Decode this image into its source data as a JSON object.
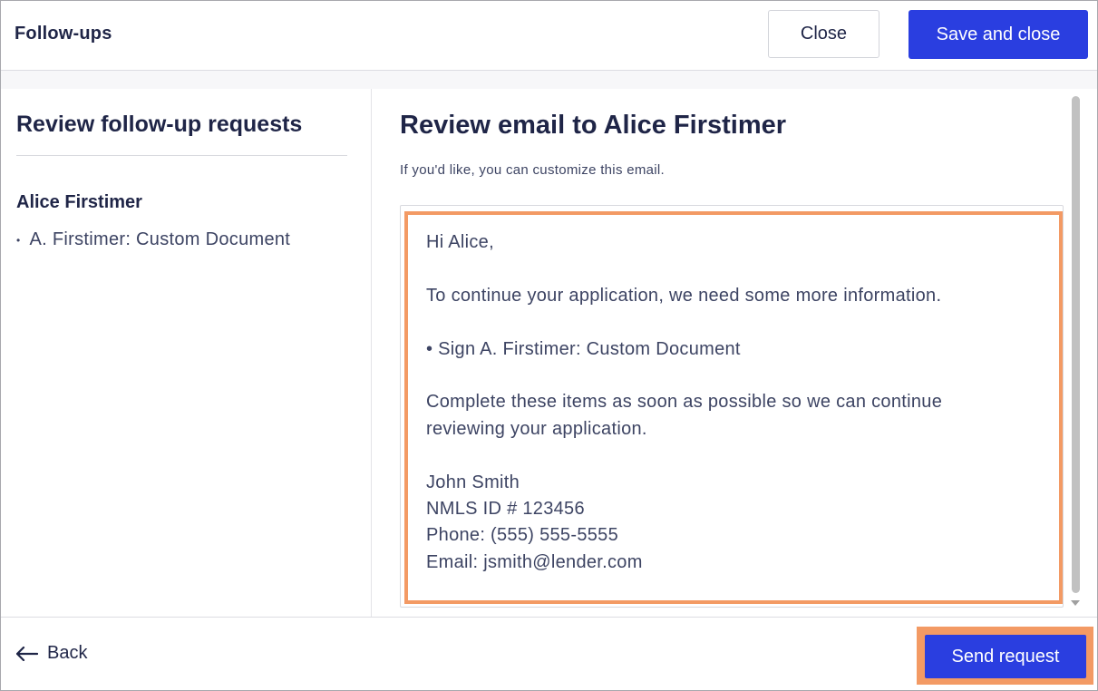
{
  "header": {
    "title": "Follow-ups",
    "close_label": "Close",
    "save_label": "Save and close"
  },
  "left_panel": {
    "heading": "Review follow-up requests",
    "borrower_name": "Alice Firstimer",
    "items": [
      {
        "bullet": "•",
        "label": "A. Firstimer: Custom Document"
      }
    ]
  },
  "right_panel": {
    "heading": "Review email to Alice Firstimer",
    "subtext": "If you'd like, you can customize this email.",
    "email": {
      "greeting": "Hi Alice,",
      "intro": "To continue your application, we need some more information.",
      "request_item": "• Sign A. Firstimer: Custom Document",
      "closing_line1": "Complete these items as soon as possible so we can continue",
      "closing_line2": "reviewing your application.",
      "sig_name": "John Smith",
      "sig_nmls": "NMLS ID # 123456",
      "sig_phone": "Phone: (555) 555-5555",
      "sig_email": "Email: jsmith@lender.com"
    }
  },
  "footer": {
    "back_label": "Back",
    "send_label": "Send request"
  },
  "colors": {
    "primary": "#2a3ee0",
    "highlight": "#f39a64",
    "text_dark": "#1f2547",
    "text_body": "#3d4463"
  },
  "icons": {
    "back": "arrow-left-icon"
  }
}
